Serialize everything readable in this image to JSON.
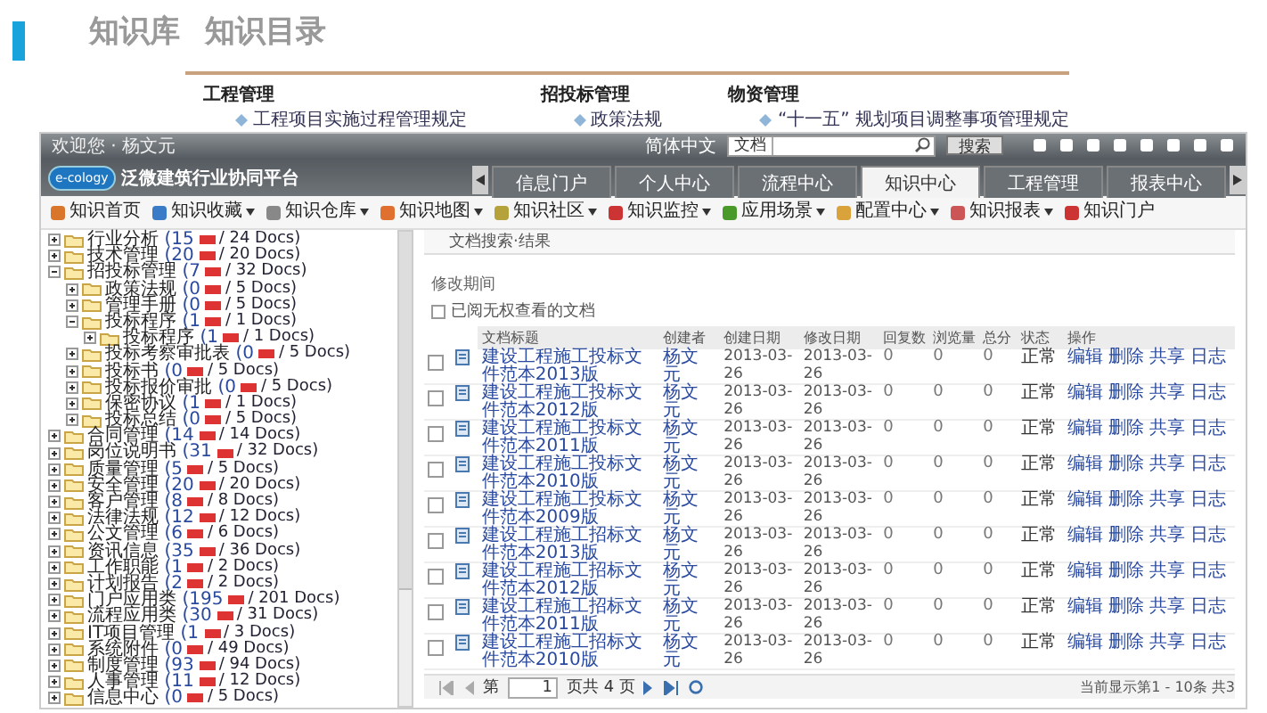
{
  "page_header": {
    "crumbs": [
      "知识库",
      "知识目录"
    ]
  },
  "catalog": [
    {
      "heading": "工程管理",
      "link": "工程项目实施过程管理规定"
    },
    {
      "heading": "招投标管理",
      "link": "政策法规"
    },
    {
      "heading": "物资管理",
      "link": "“十一五” 规划项目调整事项管理规定"
    }
  ],
  "app": {
    "top_bar": {
      "user": "欢迎您 · 杨文元",
      "language": "简体中文",
      "search_scope": "文档",
      "search_button": "搜索"
    },
    "logo": {
      "brand": "e-cology",
      "title": "泛微建筑行业协同平台"
    },
    "tabs": [
      {
        "label": "信息门户",
        "selected": false
      },
      {
        "label": "个人中心",
        "selected": false
      },
      {
        "label": "流程中心",
        "selected": false
      },
      {
        "label": "知识中心",
        "selected": true
      },
      {
        "label": "工程管理",
        "selected": false
      },
      {
        "label": "报表中心",
        "selected": false
      }
    ],
    "toolbar": [
      {
        "label": "知识首页",
        "dropdown": false
      },
      {
        "label": "知识收藏",
        "dropdown": true
      },
      {
        "label": "知识仓库",
        "dropdown": true
      },
      {
        "label": "知识地图",
        "dropdown": true
      },
      {
        "label": "知识社区",
        "dropdown": true
      },
      {
        "label": "知识监控",
        "dropdown": true
      },
      {
        "label": "应用场景",
        "dropdown": true
      },
      {
        "label": "配置中心",
        "dropdown": true
      },
      {
        "label": "知识报表",
        "dropdown": true
      },
      {
        "label": "知识门户",
        "dropdown": false
      }
    ],
    "tree": [
      {
        "label": "行业分析",
        "new": "(15",
        "total": "/ 24 Docs)",
        "expanded": false
      },
      {
        "label": "技术管理",
        "new": "(20",
        "total": "/ 20 Docs)",
        "expanded": false
      },
      {
        "label": "招投标管理",
        "new": "(7",
        "total": "/ 32 Docs)",
        "expanded": true,
        "children": [
          {
            "label": "政策法规",
            "new": "(0",
            "total": "/ 5 Docs)",
            "expanded": false
          },
          {
            "label": "管理手册",
            "new": "(0",
            "total": "/ 5 Docs)",
            "expanded": false
          },
          {
            "label": "投标程序",
            "new": "(1",
            "total": "/ 1 Docs)",
            "expanded": true,
            "children": [
              {
                "label": "投标程序",
                "new": "(1",
                "total": "/ 1 Docs)",
                "expanded": false
              }
            ]
          },
          {
            "label": "投标考察审批表",
            "new": "(0",
            "total": "/ 5 Docs)",
            "expanded": false
          },
          {
            "label": "投标书",
            "new": "(0",
            "total": "/ 5 Docs)",
            "expanded": false
          },
          {
            "label": "投标报价审批",
            "new": "(0",
            "total": "/ 5 Docs)",
            "expanded": false
          },
          {
            "label": "保密协议",
            "new": "(1",
            "total": "/ 1 Docs)",
            "expanded": false
          },
          {
            "label": "投标总结",
            "new": "(0",
            "total": "/ 5 Docs)",
            "expanded": false
          }
        ]
      },
      {
        "label": "合同管理",
        "new": "(14",
        "total": "/ 14 Docs)",
        "expanded": false
      },
      {
        "label": "岗位说明书",
        "new": "(31",
        "total": "/ 32 Docs)",
        "expanded": false
      },
      {
        "label": "质量管理",
        "new": "(5",
        "total": "/ 5 Docs)",
        "expanded": false
      },
      {
        "label": "安全管理",
        "new": "(20",
        "total": "/ 20 Docs)",
        "expanded": false
      },
      {
        "label": "客户管理",
        "new": "(8",
        "total": "/ 8 Docs)",
        "expanded": false
      },
      {
        "label": "法律法规",
        "new": "(12",
        "total": "/ 12 Docs)",
        "expanded": false
      },
      {
        "label": "公文管理",
        "new": "(6",
        "total": "/ 6 Docs)",
        "expanded": false
      },
      {
        "label": "资讯信息",
        "new": "(35",
        "total": "/ 36 Docs)",
        "expanded": false
      },
      {
        "label": "工作职能",
        "new": "(1",
        "total": "/ 2 Docs)",
        "expanded": false
      },
      {
        "label": "计划报告",
        "new": "(2",
        "total": "/ 2 Docs)",
        "expanded": false
      },
      {
        "label": "门户应用类",
        "new": "(195",
        "total": "/ 201 Docs)",
        "expanded": false
      },
      {
        "label": "流程应用类",
        "new": "(30",
        "total": "/ 31 Docs)",
        "expanded": false
      },
      {
        "label": "IT项目管理",
        "new": "(1",
        "total": "/ 3 Docs)",
        "expanded": false
      },
      {
        "label": "系统附件",
        "new": "(0",
        "total": "/ 49 Docs)",
        "expanded": false
      },
      {
        "label": "制度管理",
        "new": "(93",
        "total": "/ 94 Docs)",
        "expanded": false
      },
      {
        "label": "人事管理",
        "new": "(11",
        "total": "/ 12 Docs)",
        "expanded": false
      },
      {
        "label": "信息中心",
        "new": "(0",
        "total": "/ 5 Docs)",
        "expanded": false
      }
    ],
    "results": {
      "title": "文档搜索·结果",
      "filter_label": "修改期间",
      "notice": "已阅无权查看的文档",
      "columns": [
        "文档标题",
        "创建者",
        "创建日期",
        "修改日期",
        "回复数",
        "浏览量",
        "总分",
        "状态",
        "操作"
      ],
      "rows": [
        {
          "title": "建设工程施工投标文件范本2013版",
          "author": "杨文元",
          "created": "2013-03-26",
          "modified": "2013-03-26",
          "replies": "0",
          "views": "0",
          "score": "0",
          "status": "正常",
          "actions": [
            "编辑",
            "删除",
            "共享",
            "日志"
          ],
          "checked": false
        },
        {
          "title": "建设工程施工投标文件范本2012版",
          "author": "杨文元",
          "created": "2013-03-26",
          "modified": "2013-03-26",
          "replies": "0",
          "views": "0",
          "score": "0",
          "status": "正常",
          "actions": [
            "编辑",
            "删除",
            "共享",
            "日志"
          ],
          "checked": false
        },
        {
          "title": "建设工程施工投标文件范本2011版",
          "author": "杨文元",
          "created": "2013-03-26",
          "modified": "2013-03-26",
          "replies": "0",
          "views": "0",
          "score": "0",
          "status": "正常",
          "actions": [
            "编辑",
            "删除",
            "共享",
            "日志"
          ],
          "checked": false
        },
        {
          "title": "建设工程施工投标文件范本2010版",
          "author": "杨文元",
          "created": "2013-03-26",
          "modified": "2013-03-26",
          "replies": "0",
          "views": "0",
          "score": "0",
          "status": "正常",
          "actions": [
            "编辑",
            "删除",
            "共享",
            "日志"
          ],
          "checked": false
        },
        {
          "title": "建设工程施工投标文件范本2009版",
          "author": "杨文元",
          "created": "2013-03-26",
          "modified": "2013-03-26",
          "replies": "0",
          "views": "0",
          "score": "0",
          "status": "正常",
          "actions": [
            "编辑",
            "删除",
            "共享",
            "日志"
          ],
          "checked": false
        },
        {
          "title": "建设工程施工招标文件范本2013版",
          "author": "杨文元",
          "created": "2013-03-26",
          "modified": "2013-03-26",
          "replies": "0",
          "views": "0",
          "score": "0",
          "status": "正常",
          "actions": [
            "编辑",
            "删除",
            "共享",
            "日志"
          ],
          "checked": false
        },
        {
          "title": "建设工程施工招标文件范本2012版",
          "author": "杨文元",
          "created": "2013-03-26",
          "modified": "2013-03-26",
          "replies": "0",
          "views": "0",
          "score": "0",
          "status": "正常",
          "actions": [
            "编辑",
            "删除",
            "共享",
            "日志"
          ],
          "checked": false
        },
        {
          "title": "建设工程施工招标文件范本2011版",
          "author": "杨文元",
          "created": "2013-03-26",
          "modified": "2013-03-26",
          "replies": "0",
          "views": "0",
          "score": "0",
          "status": "正常",
          "actions": [
            "编辑",
            "删除",
            "共享",
            "日志"
          ],
          "checked": false
        },
        {
          "title": "建设工程施工招标文件范本2010版",
          "author": "杨文元",
          "created": "2013-03-26",
          "modified": "2013-03-26",
          "replies": "0",
          "views": "0",
          "score": "0",
          "status": "正常",
          "actions": [
            "编辑",
            "删除",
            "共享",
            "日志"
          ],
          "checked": false
        }
      ],
      "pager": {
        "prefix": "第",
        "page": "1",
        "suffix": "页共 4 页",
        "summary": "当前显示第1 - 10条 共3"
      }
    }
  }
}
